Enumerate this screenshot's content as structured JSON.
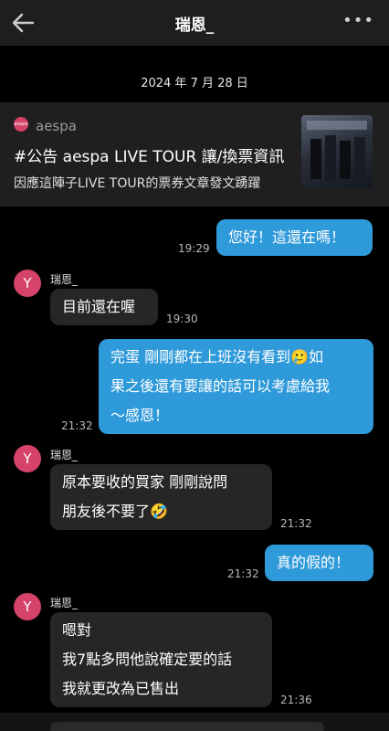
{
  "header": {
    "title": "瑞恩_"
  },
  "date_separator": "2024 年 7 月 28 日",
  "card": {
    "logo_text": "aespa",
    "source": "aespa",
    "title": "#公告 aespa LIVE TOUR 讓/換票資訊",
    "description": "因應這陣子LIVE TOUR的票券文章發文踴躍",
    "thumbnail_icon": "aespa-tour-poster-image"
  },
  "sender_name": "瑞恩_",
  "avatar_letter": "Y",
  "messages": [
    {
      "direction": "out",
      "lines": [
        "您好！這還在嗎！"
      ],
      "time": "19:29"
    },
    {
      "direction": "in",
      "lines": [
        "目前還在喔"
      ],
      "time": "19:30"
    },
    {
      "direction": "out",
      "lines": [
        "完蛋 剛剛都在上班沒有看到🥲如",
        "果之後還有要讓的話可以考慮給我",
        "～感恩！"
      ],
      "time": "21:32"
    },
    {
      "direction": "in",
      "lines": [
        "原本要收的買家 剛剛說問",
        "朋友後不要了🤣"
      ],
      "time": "21:32"
    },
    {
      "direction": "out",
      "lines": [
        "真的假的！"
      ],
      "time": "21:32"
    },
    {
      "direction": "in",
      "lines": [
        "嗯對",
        "我7點多問他說確定要的話",
        "我就更改為已售出"
      ],
      "time": "21:36"
    }
  ],
  "colors": {
    "accent": "#2f9ad9",
    "avatar": "#d5426a",
    "incoming_bubble": "#262626"
  }
}
